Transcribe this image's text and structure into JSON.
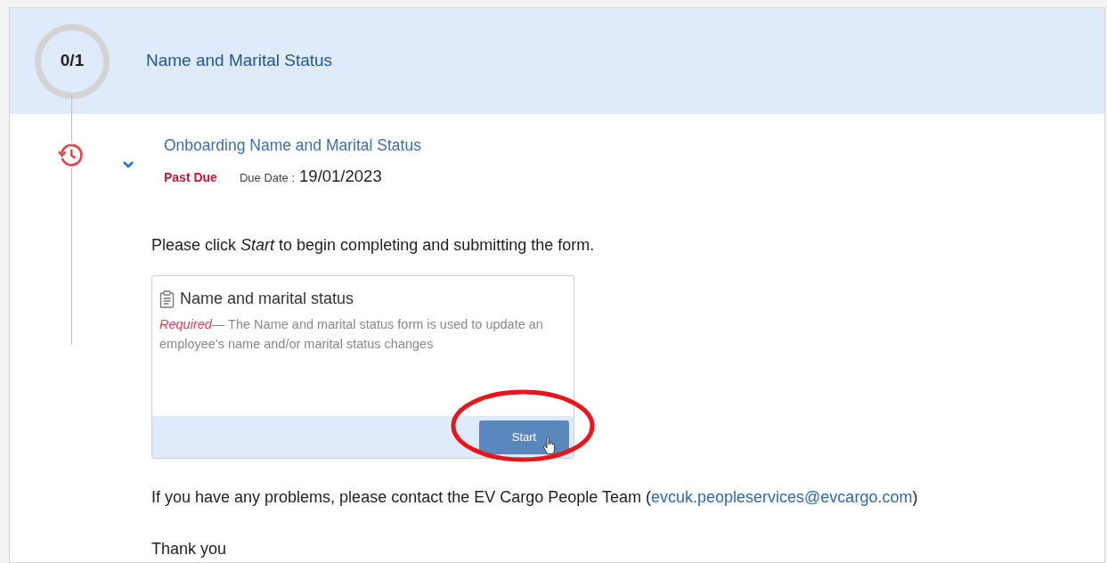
{
  "section": {
    "progress": "0/1",
    "title": "Name and Marital Status"
  },
  "task": {
    "title": "Onboarding Name and Marital Status",
    "expanded": true,
    "status": "Past Due",
    "due_label": "Due Date :",
    "due_date": "19/01/2023"
  },
  "instruction": "Please click *Start* to begin completing and submitting the form.",
  "form_card": {
    "title": "Name and marital status",
    "description": "*Required*— The Name and marital status form is used to update an employee's name and/or marital status changes",
    "button": "Start"
  },
  "contact": {
    "before": "If you have any problems, please contact the EV Cargo People Team (",
    "link": "evcuk.peopleservices@evcargo.com",
    "after": ")"
  },
  "closing": "Thank you"
}
